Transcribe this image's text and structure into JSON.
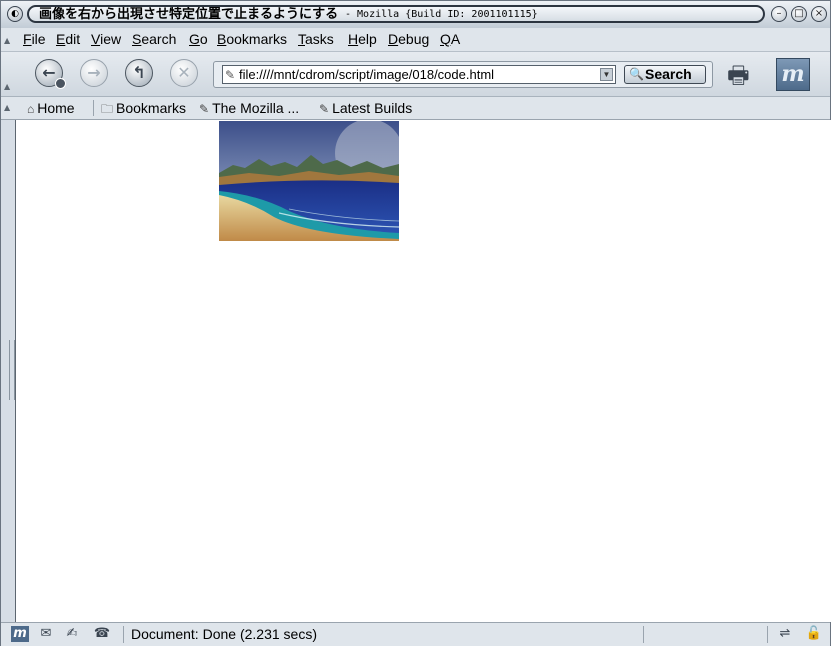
{
  "window": {
    "title_main": "画像を右から出現させ特定位置で止まるようにする",
    "title_sub": "- Mozilla {Build ID: 2001101115}"
  },
  "menu": {
    "items": [
      "File",
      "Edit",
      "View",
      "Search",
      "Go",
      "Bookmarks",
      "Tasks",
      "Help",
      "Debug",
      "QA"
    ]
  },
  "navigation": {
    "url": "file:////mnt/cdrom/script/image/018/code.html",
    "search_label": "Search"
  },
  "personal_toolbar": {
    "items": [
      "Home",
      "Bookmarks",
      "The Mozilla ...",
      "Latest Builds"
    ]
  },
  "status": {
    "text": "Document: Done (2.231 secs)"
  },
  "icons": {
    "back": "back-arrow-icon",
    "forward": "forward-arrow-icon",
    "reload": "reload-icon",
    "stop": "stop-icon",
    "print": "print-icon",
    "logo": "mozilla-logo-icon"
  },
  "colors": {
    "chrome": "#dfe5eb",
    "accent": "#4d6a8a"
  }
}
